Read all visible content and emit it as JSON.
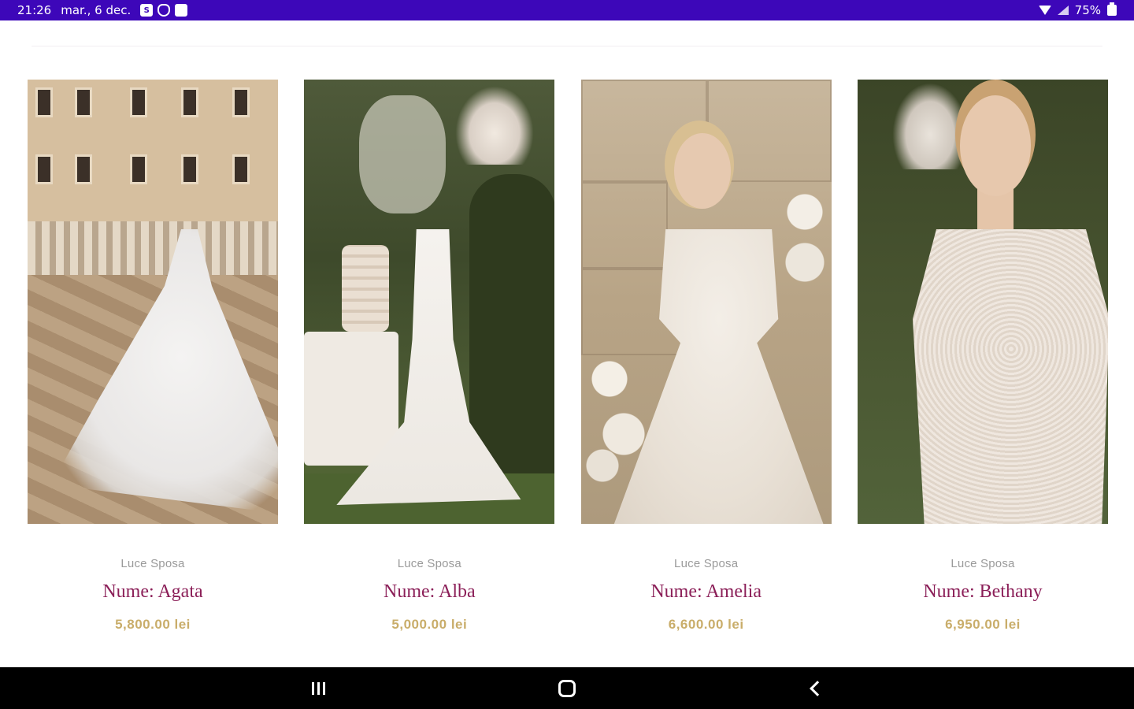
{
  "status_bar": {
    "time": "21:26",
    "date": "mar., 6 dec.",
    "notification_icons": [
      "s-icon",
      "shield-icon",
      "gallery-icon"
    ],
    "battery": "75%",
    "color": "#3d07b9"
  },
  "products": [
    {
      "brand": "Luce Sposa",
      "name": "Nume: Agata",
      "price": "5,800.00 lei"
    },
    {
      "brand": "Luce Sposa",
      "name": "Nume: Alba",
      "price": "5,000.00 lei"
    },
    {
      "brand": "Luce Sposa",
      "name": "Nume: Amelia",
      "price": "6,600.00 lei"
    },
    {
      "brand": "Luce Sposa",
      "name": "Nume: Bethany",
      "price": "6,950.00 lei"
    }
  ],
  "colors": {
    "name": "#8b1f58",
    "price": "#c9ad6a",
    "brand": "#9a9a9a"
  },
  "nav_bar": {
    "buttons": [
      "recents-icon",
      "home-icon",
      "back-icon"
    ]
  }
}
